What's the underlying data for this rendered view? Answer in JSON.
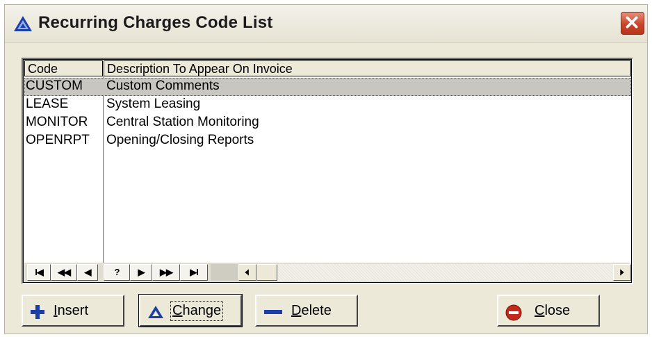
{
  "window": {
    "title": "Recurring Charges Code List"
  },
  "grid": {
    "columns": [
      "Code",
      "Description To Appear On Invoice"
    ],
    "rows": [
      {
        "code": "CUSTOM",
        "description": "Custom Comments",
        "selected": true
      },
      {
        "code": "LEASE",
        "description": "System Leasing",
        "selected": false
      },
      {
        "code": "MONITOR",
        "description": "Central Station Monitoring",
        "selected": false
      },
      {
        "code": "OPENRPT",
        "description": "Opening/Closing Reports",
        "selected": false
      }
    ]
  },
  "navigator": {
    "buttons": [
      {
        "name": "first-record",
        "glyph": "I◀"
      },
      {
        "name": "prior-page",
        "glyph": "◀◀"
      },
      {
        "name": "prior-record",
        "glyph": "◀"
      },
      {
        "name": "help",
        "glyph": "?"
      },
      {
        "name": "next-record",
        "glyph": "▶"
      },
      {
        "name": "next-page",
        "glyph": "▶▶"
      },
      {
        "name": "last-record",
        "glyph": "▶I"
      }
    ]
  },
  "buttons": {
    "insert": "Insert",
    "change": "Change",
    "delete": "Delete",
    "close": "Close"
  },
  "icons": {
    "app": "blue-triangle-icon",
    "insert": "plus-icon",
    "change": "triangle-icon",
    "delete": "minus-icon",
    "close": "stop-icon"
  },
  "colors": {
    "window_bg": "#ece9d8",
    "accent_blue": "#1c3fa8",
    "close_red": "#c9452a",
    "selected_row": "#c8c6c0"
  }
}
